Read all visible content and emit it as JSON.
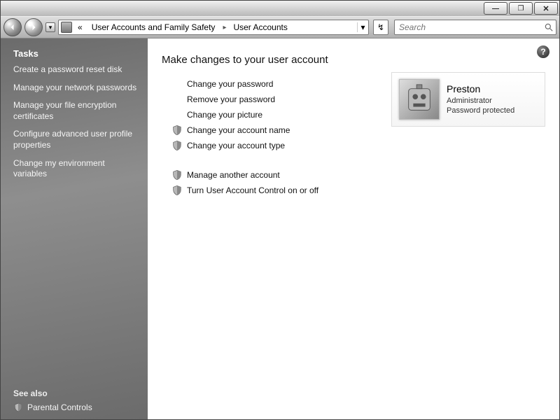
{
  "breadcrumb": {
    "sep1": "«",
    "parent": "User Accounts and Family Safety",
    "chev": "▸",
    "current": "User Accounts"
  },
  "search": {
    "placeholder": "Search"
  },
  "help_symbol": "?",
  "heading": "Make changes to your user account",
  "ops": {
    "change_pw": "Change your password",
    "remove_pw": "Remove your password",
    "change_pic": "Change your picture",
    "change_name": "Change your account name",
    "change_type": "Change your account type",
    "manage_other": "Manage another account",
    "uac_toggle": "Turn User Account Control on or off"
  },
  "user": {
    "name": "Preston",
    "role": "Administrator",
    "pw": "Password protected"
  },
  "sidebar": {
    "tasks_heading": "Tasks",
    "items": [
      "Create a password reset disk",
      "Manage your network passwords",
      "Manage your file encryption certificates",
      "Configure advanced user profile properties",
      "Change my environment variables"
    ],
    "seealso_heading": "See also",
    "seealso": "Parental Controls"
  }
}
